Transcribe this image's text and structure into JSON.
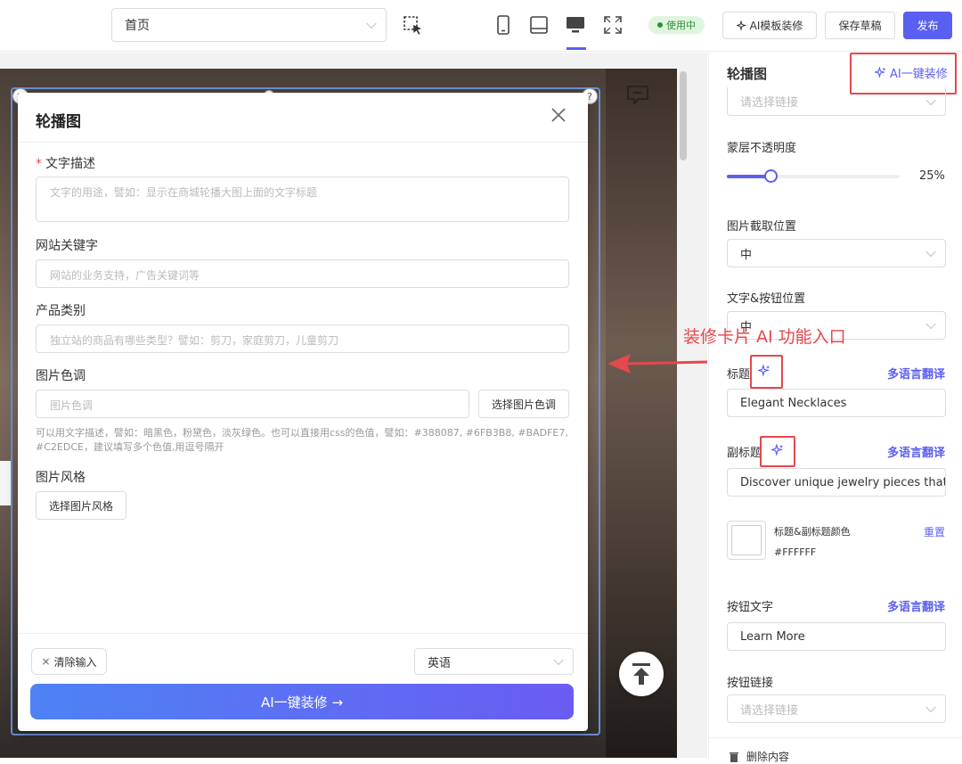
{
  "toolbar": {
    "page_select": "首页",
    "status": "使用中",
    "ai_template": "AI模板装修",
    "save_draft": "保存草稿",
    "publish": "发布"
  },
  "modal": {
    "title": "轮播图",
    "text_desc_label": "文字描述",
    "text_desc_placeholder": "文字的用途，譬如：显示在商城轮播大图上面的文字标题",
    "keywords_label": "网站关键字",
    "keywords_placeholder": "网站的业务支持，广告关键词等",
    "category_label": "产品类别",
    "category_placeholder": "独立站的商品有哪些类型？譬如：剪刀，家庭剪刀，儿童剪刀",
    "tone_label": "图片色调",
    "tone_placeholder": "图片色调",
    "tone_button": "选择图片色调",
    "tone_hint": "可以用文字描述，譬如：暗黑色，粉黛色，淡灰绿色。也可以直接用css的色值，譬如：#388087, #6FB3B8, #BADFE7, #C2EDCE，建议填写多个色值,用逗号隔开",
    "style_label": "图片风格",
    "style_button": "选择图片风格",
    "clear_button": "清除输入",
    "language": "英语",
    "ai_button": "AI一键装修 →"
  },
  "panel": {
    "title": "轮播图",
    "ai_link": "AI一键装修",
    "link_placeholder": "请选择链接",
    "opacity_label": "蒙层不透明度",
    "opacity_value": "25%",
    "opacity_fraction": 0.25,
    "crop_label": "图片截取位置",
    "crop_value": "中",
    "text_pos_label": "文字&按钮位置",
    "text_pos_value": "中",
    "heading_label": "标题",
    "translate": "多语言翻译",
    "heading_value": "Elegant Necklaces",
    "subheading_label": "副标题",
    "subheading_value": "Discover unique jewelry pieces that ele",
    "color_label": "标题&副标题颜色",
    "color_value": "#FFFFFF",
    "reset": "重置",
    "btn_text_label": "按钮文字",
    "btn_text_value": "Learn More",
    "btn_link_label": "按钮链接",
    "btn_link_placeholder": "请选择链接",
    "delete_label": "删除内容"
  },
  "annotation": "装修卡片 AI 功能入口",
  "colors": {
    "accent": "#5b5ff0",
    "annotation_red": "#e5484d"
  }
}
